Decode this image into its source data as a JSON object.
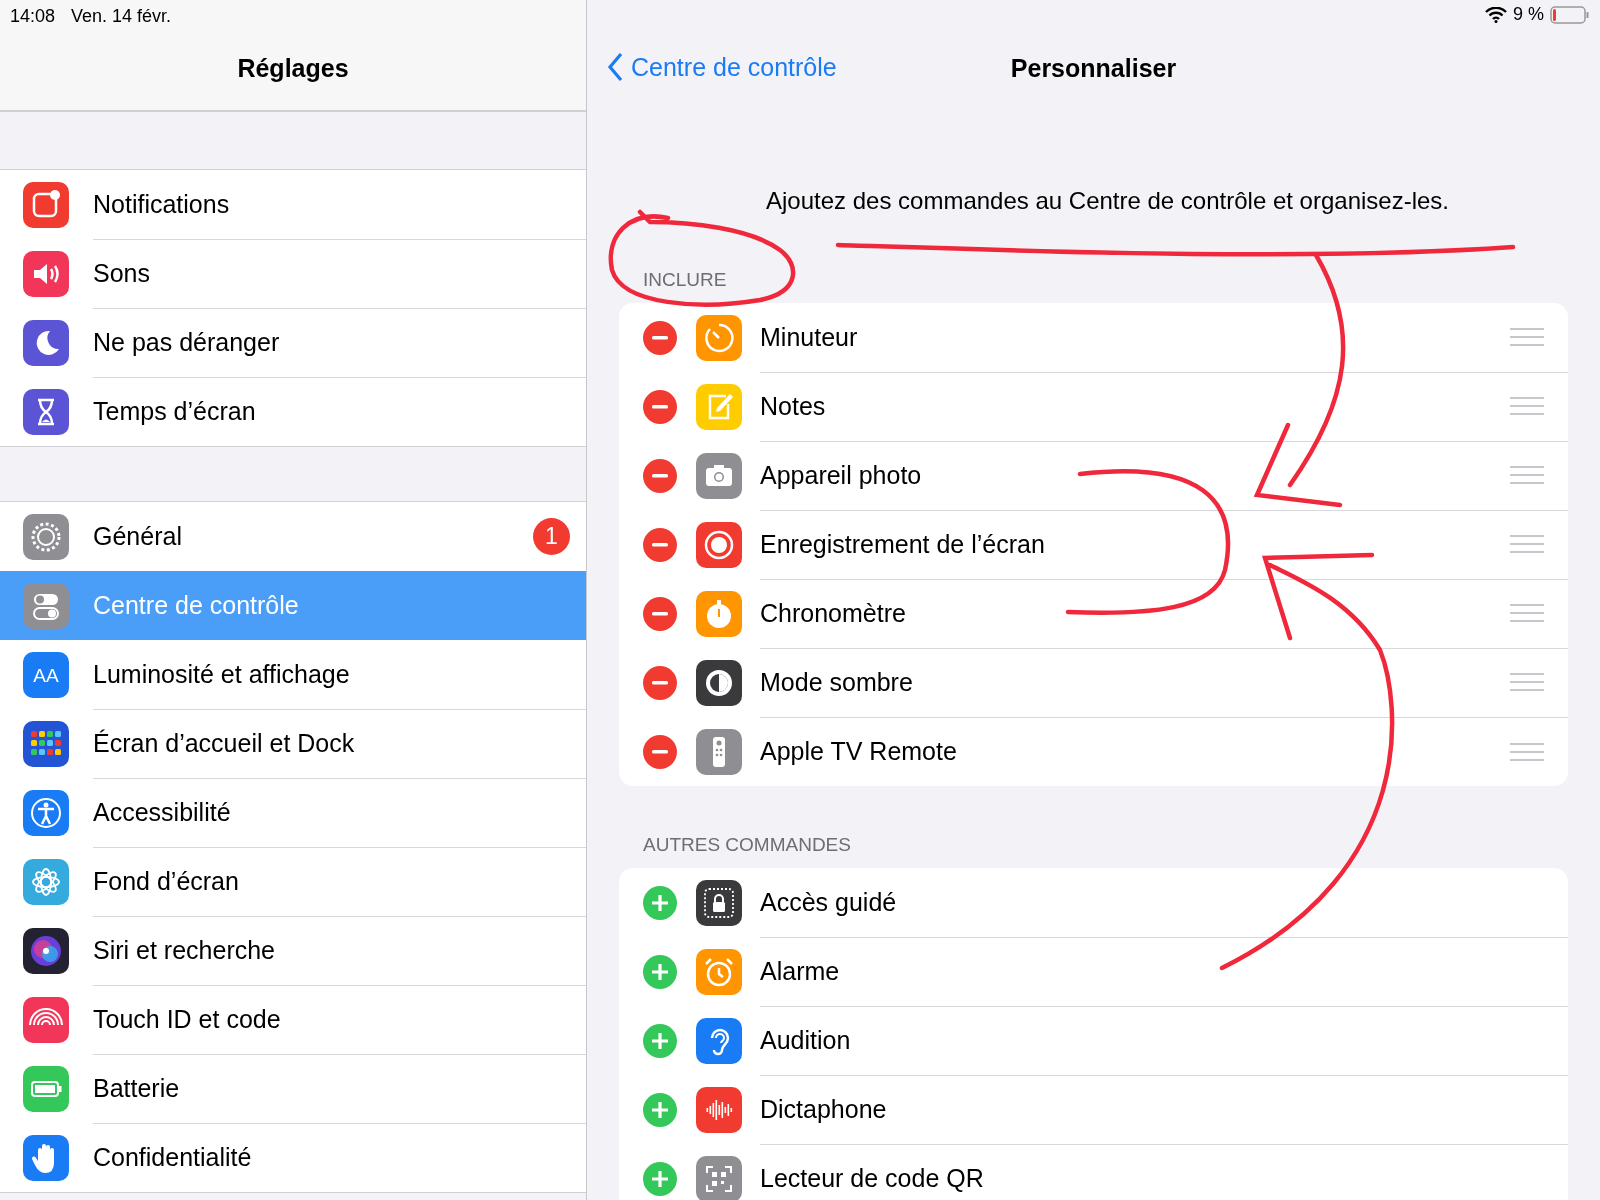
{
  "status_bar": {
    "time": "14:08",
    "date": "Ven. 14 févr.",
    "battery": "9 %"
  },
  "sidebar": {
    "title": "Réglages",
    "groups": [
      [
        {
          "label": "Notifications",
          "kind": "notifications",
          "color": "#f23b30",
          "selected": false
        },
        {
          "label": "Sons",
          "kind": "sound",
          "color": "#f2365a",
          "selected": false
        },
        {
          "label": "Ne pas déranger",
          "kind": "moon",
          "color": "#5b55d6",
          "selected": false
        },
        {
          "label": "Temps d’écran",
          "kind": "hourglass",
          "color": "#5b55d6",
          "selected": false
        }
      ],
      [
        {
          "label": "Général",
          "kind": "gear",
          "color": "#8e8e93",
          "selected": false,
          "badge": "1"
        },
        {
          "label": "Centre de contrôle",
          "kind": "toggles",
          "color": "#8e8e93",
          "selected": true
        },
        {
          "label": "Luminosité et affichage",
          "kind": "text",
          "glyph": "AA",
          "color": "#1a7cf5",
          "selected": false
        },
        {
          "label": "Écran d’accueil et Dock",
          "kind": "grid",
          "color": "#2354d6",
          "selected": false
        },
        {
          "label": "Accessibilité",
          "kind": "person",
          "color": "#1a7cf5",
          "selected": false
        },
        {
          "label": "Fond d’écran",
          "kind": "flower",
          "color": "#35aadc",
          "selected": false
        },
        {
          "label": "Siri et recherche",
          "kind": "orb",
          "color": "#222233",
          "selected": false
        },
        {
          "label": "Touch ID et code",
          "kind": "fingerprint",
          "color": "#f2365a",
          "selected": false
        },
        {
          "label": "Batterie",
          "kind": "battery",
          "color": "#34c759",
          "selected": false
        },
        {
          "label": "Confidentialité",
          "kind": "hand",
          "color": "#1a7cf5",
          "selected": false
        }
      ]
    ]
  },
  "detail": {
    "back": "Centre de contrôle",
    "title": "Personnaliser",
    "description": "Ajoutez des commandes au Centre de contrôle et organisez-les.",
    "sections": [
      {
        "header": "INCLURE",
        "kind": "included",
        "items": [
          {
            "label": "Minuteur",
            "kind": "timer",
            "color": "#ff9500"
          },
          {
            "label": "Notes",
            "kind": "note",
            "color": "#ffcc00"
          },
          {
            "label": "Appareil photo",
            "kind": "camera",
            "color": "#8e8e93"
          },
          {
            "label": "Enregistrement de l’écran",
            "kind": "record",
            "color": "#f23b30"
          },
          {
            "label": "Chronomètre",
            "kind": "stopwatch",
            "color": "#ff9500"
          },
          {
            "label": "Mode sombre",
            "kind": "contrast",
            "color": "#3a3a3c"
          },
          {
            "label": "Apple TV Remote",
            "kind": "remote",
            "color": "#8e8e93"
          }
        ]
      },
      {
        "header": "AUTRES COMMANDES",
        "kind": "available",
        "items": [
          {
            "label": "Accès guidé",
            "kind": "lock",
            "color": "#3a3a3c"
          },
          {
            "label": "Alarme",
            "kind": "alarm",
            "color": "#ff9500"
          },
          {
            "label": "Audition",
            "kind": "ear",
            "color": "#1a7cf5"
          },
          {
            "label": "Dictaphone",
            "kind": "wave",
            "color": "#f23b30"
          },
          {
            "label": "Lecteur de code QR",
            "kind": "qr",
            "color": "#8e8e93"
          }
        ]
      }
    ]
  }
}
